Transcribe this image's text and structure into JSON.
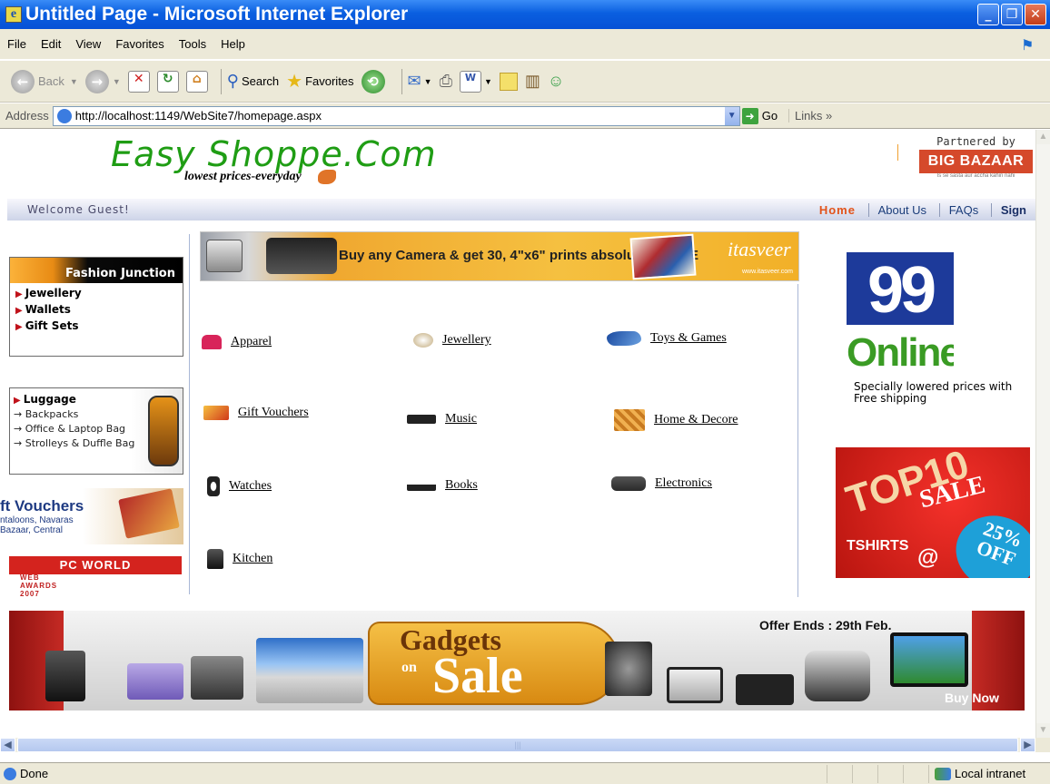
{
  "window": {
    "title": "Untitled Page - Microsoft Internet Explorer"
  },
  "menu": [
    "File",
    "Edit",
    "View",
    "Favorites",
    "Tools",
    "Help"
  ],
  "toolbar": {
    "back": "Back",
    "search": "Search",
    "favorites": "Favorites"
  },
  "address": {
    "label": "Address",
    "url": "http://localhost:1149/WebSite7/homepage.aspx",
    "go": "Go",
    "links": "Links"
  },
  "site": {
    "logo": "Easy Shoppe.Com",
    "tagline": "lowest prices-everyday",
    "partner_label": "Partnered by",
    "partner_name": "BIG BAZAAR",
    "partner_sub": "Is se sasta aur accha kahin nahi",
    "welcome": "Welcome Guest!",
    "nav": [
      "Home",
      "About Us",
      "FAQs",
      "Sign"
    ]
  },
  "left_ads": {
    "fashion_title": "Fashion Junction",
    "fashion_items": [
      "Jewellery",
      "Wallets",
      "Gift Sets"
    ],
    "luggage_title": "Luggage",
    "luggage_items": [
      "Backpacks",
      "Office & Laptop Bag",
      "Strolleys & Duffle Bag"
    ],
    "vouchers_title": "ft Vouchers",
    "vouchers_line1": "ntaloons, Navaras",
    "vouchers_line2": "Bazaar, Central",
    "pcworld": "PC WORLD",
    "pcworld_sub": "WEB AWARDS 2007"
  },
  "banner": {
    "text": "Buy any Camera & get 30, 4\"x6\" prints absolutely FREE",
    "brand": "itasveer",
    "url": "www.itasveer.com"
  },
  "categories": [
    "Apparel",
    "Jewellery",
    "Toys & Games",
    "Gift Vouchers",
    "Music",
    "Home & Decore",
    "Watches",
    "Books",
    "Electronics",
    "Kitchen"
  ],
  "right_ads": {
    "promo99_number": "99",
    "promo99_word": "Online",
    "promo99_text": "Specially lowered prices with Free shipping",
    "top10": "TOP10",
    "top10_sale": "SALE",
    "top10_tshirts": "TSHIRTS",
    "top10_at": "@",
    "top10_off": "25% OFF"
  },
  "gadgets": {
    "line1": "Gadgets",
    "line2": "on",
    "line3": "Sale",
    "offer": "Offer Ends : 29th Feb.",
    "buy": "Buy Now"
  },
  "status": {
    "text": "Done",
    "zone": "Local intranet"
  }
}
